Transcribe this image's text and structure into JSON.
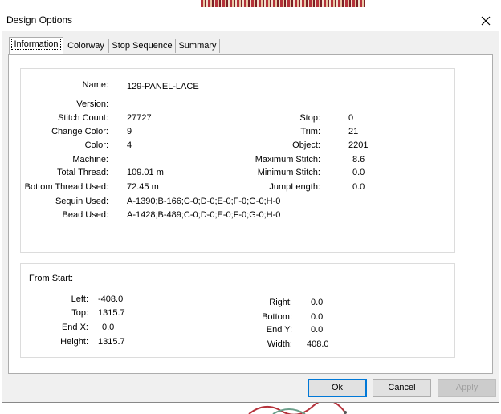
{
  "window": {
    "title": "Design Options"
  },
  "tabs": [
    "Information",
    "Colorway",
    "Stop Sequence",
    "Summary"
  ],
  "info": {
    "left": [
      {
        "label": "Name:",
        "value": "129-PANEL-LACE"
      },
      {
        "label": "Version:",
        "value": ""
      },
      {
        "label": "Stitch Count:",
        "value": "27727"
      },
      {
        "label": "Change Color:",
        "value": "9"
      },
      {
        "label": "Color:",
        "value": "4"
      },
      {
        "label": "Machine:",
        "value": ""
      },
      {
        "label": "Total Thread:",
        "value": "109.01 m"
      },
      {
        "label": "Bottom Thread Used:",
        "value": "72.45 m"
      },
      {
        "label": "Sequin Used:",
        "value": "A-1390;B-166;C-0;D-0;E-0;F-0;G-0;H-0"
      },
      {
        "label": "Bead Used:",
        "value": "A-1428;B-489;C-0;D-0;E-0;F-0;G-0;H-0"
      }
    ],
    "right": [
      {
        "label": "Stop:",
        "value": "0"
      },
      {
        "label": "Trim:",
        "value": "21"
      },
      {
        "label": "Object:",
        "value": "2201"
      },
      {
        "label": "Maximum Stitch:",
        "value": "8.6"
      },
      {
        "label": "Minimum Stitch:",
        "value": "0.0"
      },
      {
        "label": "JumpLength:",
        "value": "0.0"
      }
    ]
  },
  "from_start": {
    "heading": "From Start:",
    "left": [
      {
        "label": "Left:",
        "value": "-408.0"
      },
      {
        "label": "Top:",
        "value": "1315.7"
      },
      {
        "label": "End X:",
        "value": "0.0"
      },
      {
        "label": "Height:",
        "value": "1315.7"
      }
    ],
    "right": [
      {
        "label": "Right:",
        "value": "0.0"
      },
      {
        "label": "Bottom:",
        "value": "0.0"
      },
      {
        "label": "End Y:",
        "value": "0.0"
      },
      {
        "label": "Width:",
        "value": "408.0"
      }
    ]
  },
  "buttons": {
    "ok": "Ok",
    "cancel": "Cancel",
    "apply": "Apply"
  },
  "colors": {
    "accent": "#0078d7",
    "background_pattern": "#b5313a"
  }
}
